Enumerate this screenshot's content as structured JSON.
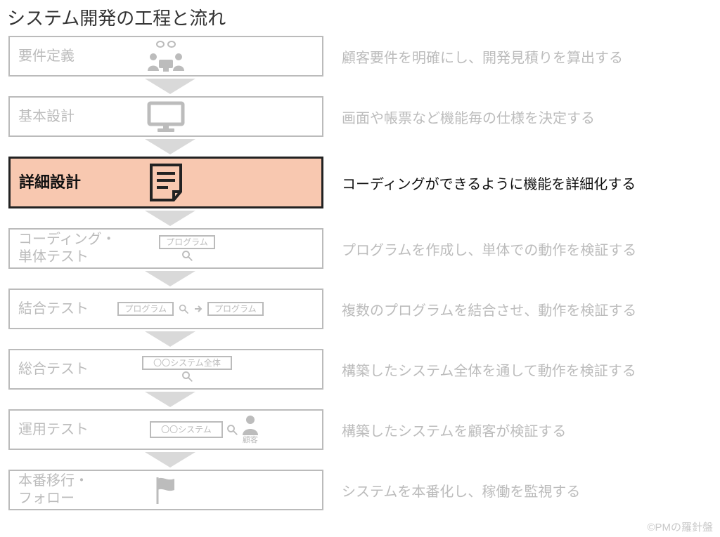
{
  "title": "システム開発の工程と流れ",
  "credit": "©PMの羅針盤",
  "phases": [
    {
      "label": "要件定義",
      "desc": "顧客要件を明確にし、開発見積りを算出する",
      "icon": "meeting",
      "highlight": false
    },
    {
      "label": "基本設計",
      "desc": "画面や帳票など機能毎の仕様を決定する",
      "icon": "monitor",
      "highlight": false
    },
    {
      "label": "詳細設計",
      "desc": "コーディングができるように機能を詳細化する",
      "icon": "document",
      "highlight": true
    },
    {
      "label": "コーディング・\n単体テスト",
      "desc": "プログラムを作成し、単体での動作を検証する",
      "icon": "program-single",
      "highlight": false,
      "program_label": "プログラム"
    },
    {
      "label": "結合テスト",
      "desc": "複数のプログラムを結合させ、動作を検証する",
      "icon": "program-link",
      "highlight": false,
      "program_label_a": "プログラム",
      "program_label_b": "プログラム"
    },
    {
      "label": "総合テスト",
      "desc": "構築したシステム全体を通して動作を検証する",
      "icon": "system-box",
      "highlight": false,
      "system_label": "〇〇システム全体"
    },
    {
      "label": "運用テスト",
      "desc": "構築したシステムを顧客が検証する",
      "icon": "system-user",
      "highlight": false,
      "system_label": "〇〇システム",
      "user_label": "顧客"
    },
    {
      "label": "本番移行・\nフォロー",
      "desc": "システムを本番化し、稼働を監視する",
      "icon": "flag",
      "highlight": false
    }
  ]
}
